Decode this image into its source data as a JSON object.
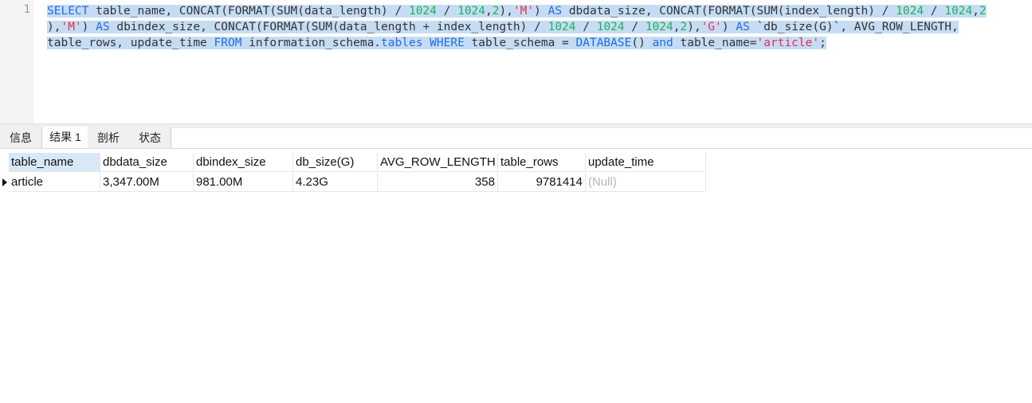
{
  "editor": {
    "line_number": "1",
    "lines": [
      [
        {
          "t": "SELECT",
          "c": "kw"
        },
        {
          "t": " table_name, CONCAT(FORMAT(SUM(data_length) / ",
          "c": ""
        },
        {
          "t": "1024",
          "c": "num"
        },
        {
          "t": " / ",
          "c": ""
        },
        {
          "t": "1024",
          "c": "num"
        },
        {
          "t": ",",
          "c": ""
        },
        {
          "t": "2",
          "c": "num"
        },
        {
          "t": "),",
          "c": ""
        },
        {
          "t": "'M'",
          "c": "str"
        },
        {
          "t": ") ",
          "c": ""
        },
        {
          "t": "AS",
          "c": "kw"
        },
        {
          "t": " dbdata_size, CONCAT(FORMAT(SUM(index_length) / ",
          "c": ""
        },
        {
          "t": "1024",
          "c": "num"
        },
        {
          "t": " / ",
          "c": ""
        },
        {
          "t": "1024",
          "c": "num"
        },
        {
          "t": ",",
          "c": ""
        },
        {
          "t": "2",
          "c": "num"
        }
      ],
      [
        {
          "t": "),",
          "c": ""
        },
        {
          "t": "'M'",
          "c": "str"
        },
        {
          "t": ") ",
          "c": ""
        },
        {
          "t": "AS",
          "c": "kw"
        },
        {
          "t": " dbindex_size, CONCAT(FORMAT(SUM(data_length + index_length) / ",
          "c": ""
        },
        {
          "t": "1024",
          "c": "num"
        },
        {
          "t": " / ",
          "c": ""
        },
        {
          "t": "1024",
          "c": "num"
        },
        {
          "t": " / ",
          "c": ""
        },
        {
          "t": "1024",
          "c": "num"
        },
        {
          "t": ",",
          "c": ""
        },
        {
          "t": "2",
          "c": "num"
        },
        {
          "t": "),",
          "c": ""
        },
        {
          "t": "'G'",
          "c": "str"
        },
        {
          "t": ") ",
          "c": ""
        },
        {
          "t": "AS",
          "c": "kw"
        },
        {
          "t": " `db_size(G)`, AVG_ROW_LENGTH,",
          "c": ""
        }
      ],
      [
        {
          "t": "table_rows, update_time ",
          "c": ""
        },
        {
          "t": "FROM",
          "c": "kw"
        },
        {
          "t": " information_schema.",
          "c": ""
        },
        {
          "t": "tables",
          "c": "kw"
        },
        {
          "t": " ",
          "c": ""
        },
        {
          "t": "WHERE",
          "c": "kw"
        },
        {
          "t": " table_schema = ",
          "c": ""
        },
        {
          "t": "DATABASE",
          "c": "kw"
        },
        {
          "t": "() ",
          "c": ""
        },
        {
          "t": "and",
          "c": "kw"
        },
        {
          "t": " table_name=",
          "c": ""
        },
        {
          "t": "'article'",
          "c": "str"
        },
        {
          "t": ";",
          "c": ""
        }
      ]
    ]
  },
  "tabs": [
    {
      "label": "信息",
      "active": false
    },
    {
      "label": "结果 1",
      "active": true
    },
    {
      "label": "剖析",
      "active": false
    },
    {
      "label": "状态",
      "active": false
    }
  ],
  "grid": {
    "columns": [
      "table_name",
      "dbdata_size",
      "dbindex_size",
      "db_size(G)",
      "AVG_ROW_LENGTH",
      "table_rows",
      "update_time"
    ],
    "rows": [
      [
        "article",
        "3,347.00M",
        "981.00M",
        "4.23G",
        "358",
        "9781414",
        "(Null)"
      ]
    ]
  }
}
